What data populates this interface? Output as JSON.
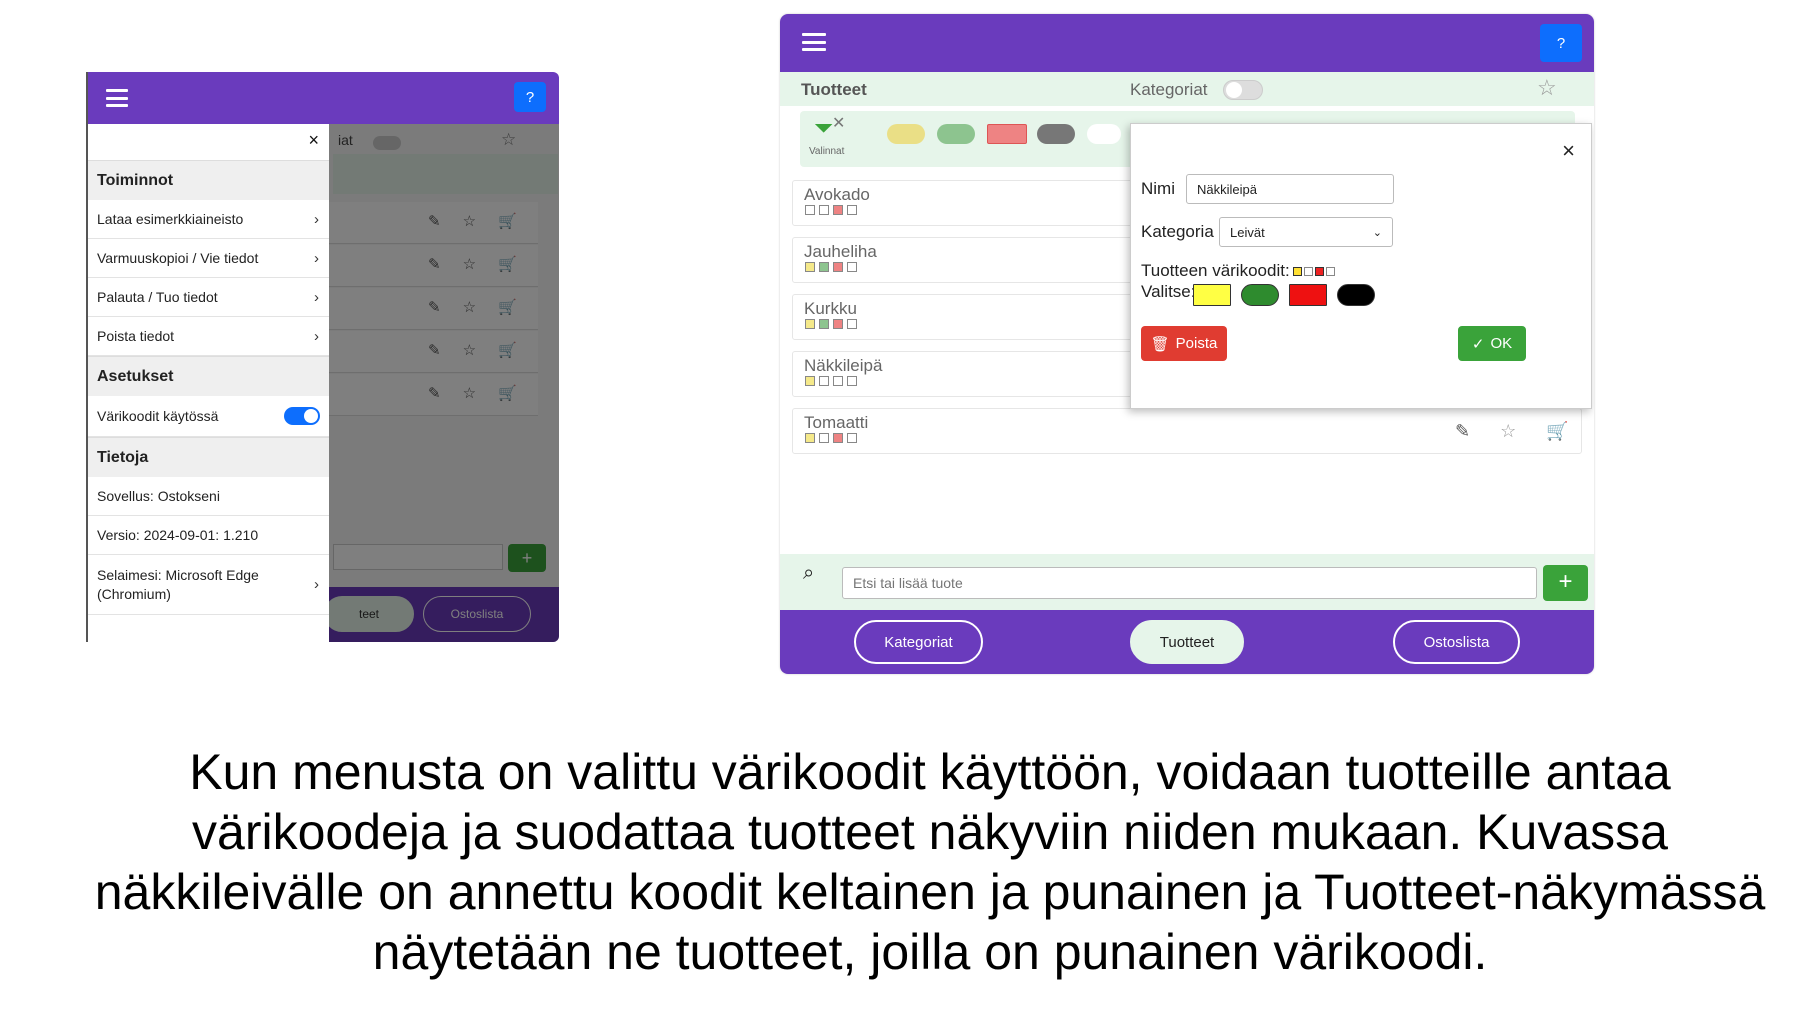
{
  "left": {
    "help_label": "?",
    "bg_header_fragment": "iat",
    "bg_nav_fragment": "teet",
    "bg_nav_ostoslista": "Ostoslista",
    "drawer": {
      "close_label": "×",
      "sections": [
        {
          "title": "Toiminnot"
        },
        {
          "title": "Asetukset"
        },
        {
          "title": "Tietoja"
        }
      ],
      "toiminnot": [
        "Lataa esimerkkiaineisto",
        "Varmuuskopioi / Vie tiedot",
        "Palauta / Tuo tiedot",
        "Poista tiedot"
      ],
      "asetukset": {
        "label": "Värikoodit käytössä",
        "enabled": true
      },
      "tietoja": {
        "app": "Sovellus: Ostokseni",
        "version": "Versio: 2024-09-01: 1.210",
        "browser": "Selaimesi: Microsoft Edge (Chromium)"
      }
    }
  },
  "right": {
    "help_label": "?",
    "tab_products": "Tuotteet",
    "tab_categories": "Kategoriat",
    "filter_label": "Valinnat",
    "filter_colors": [
      "#eadf86",
      "#8dc48f",
      "#ee8383",
      "#777777",
      "#ffffff"
    ],
    "products": [
      {
        "name": "Avokado",
        "codes": [
          "empty",
          "empty",
          "red",
          "empty"
        ]
      },
      {
        "name": "Jauheliha",
        "codes": [
          "yellow",
          "green",
          "red",
          "empty"
        ]
      },
      {
        "name": "Kurkku",
        "codes": [
          "yellow",
          "green",
          "red",
          "empty"
        ]
      },
      {
        "name": "Näkkileipä",
        "codes": [
          "yellow",
          "empty",
          "empty",
          "empty"
        ]
      },
      {
        "name": "Tomaatti",
        "codes": [
          "yellow",
          "empty",
          "red",
          "empty"
        ]
      }
    ],
    "dialog": {
      "close_label": "×",
      "name_label": "Nimi",
      "name_value": "Näkkileipä",
      "category_label": "Kategoria",
      "category_value": "Leivät",
      "codes_label": "Tuotteen värikoodit:",
      "choose_label": "Valitse:",
      "choose_colors": [
        "#ffff44",
        "#2e8b2e",
        "#ee1111",
        "#000000"
      ],
      "delete_label": "Poista",
      "ok_label": "OK"
    },
    "search_placeholder": "Etsi tai lisää tuote",
    "add_label": "+",
    "nav": [
      "Kategoriat",
      "Tuotteet",
      "Ostoslista"
    ]
  },
  "caption": "Kun menusta on valittu värikoodit käyttöön, voidaan tuotteille antaa värikoodeja ja suodattaa tuotteet näkyviin niiden mukaan. Kuvassa näkkileivälle on annettu koodit keltainen ja punainen ja Tuotteet-näkymässä näytetään ne tuotteet, joilla on punainen värikoodi."
}
